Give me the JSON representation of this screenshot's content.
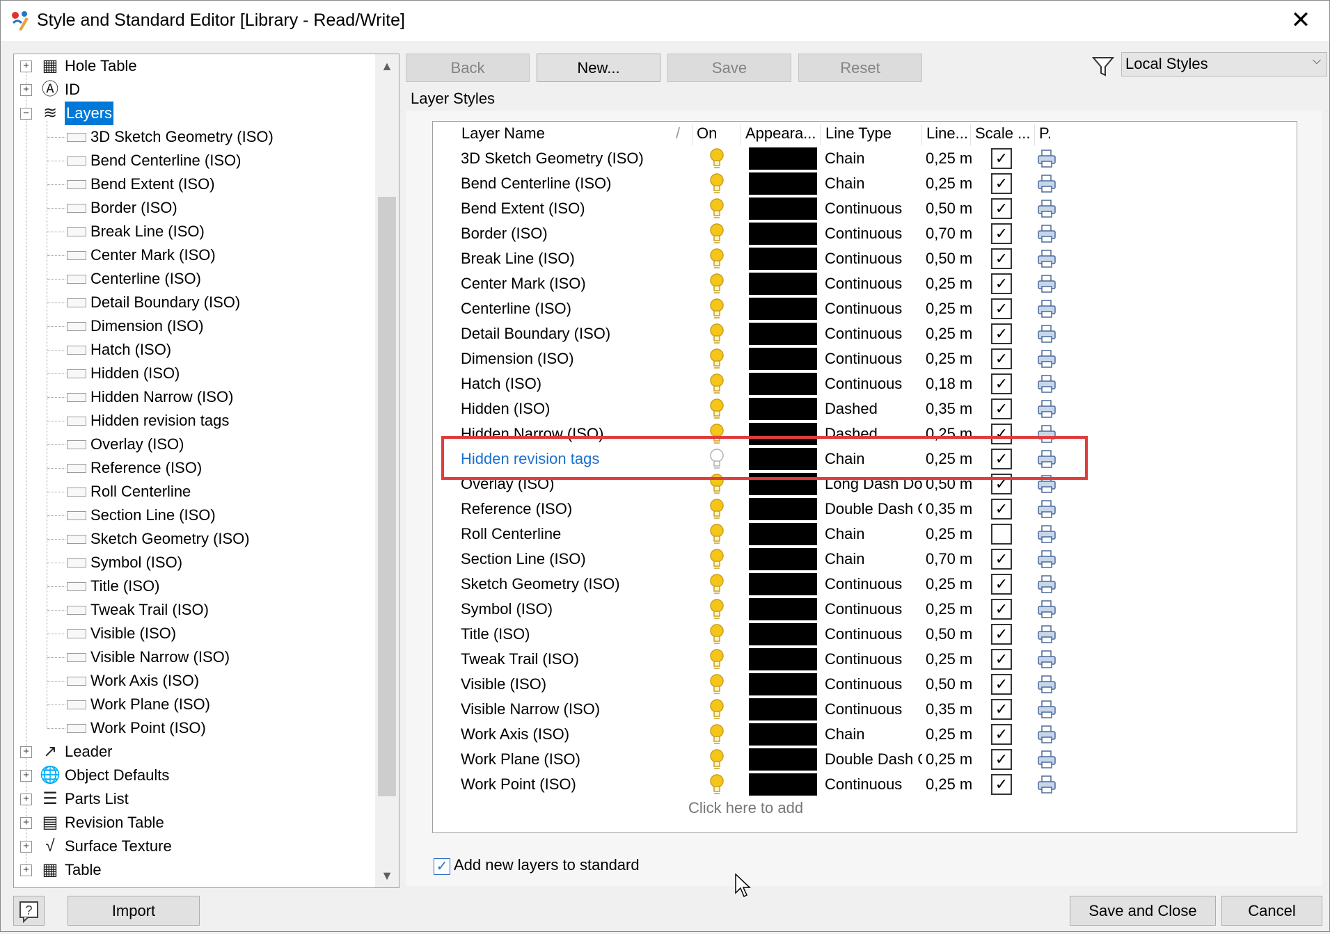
{
  "window": {
    "title": "Style and Standard Editor [Library - Read/Write]",
    "close_glyph": "✕"
  },
  "tree": {
    "top_items": [
      {
        "label": "Hole Table",
        "icon": "hole-table-icon",
        "glyph": "▦",
        "expander": "+"
      },
      {
        "label": "ID",
        "icon": "id-icon",
        "glyph": "Ⓐ",
        "expander": "+"
      },
      {
        "label": "Layers",
        "icon": "layers-icon",
        "glyph": "≋",
        "expander": "−",
        "selected": true
      }
    ],
    "layer_children": [
      "3D Sketch Geometry (ISO)",
      "Bend Centerline (ISO)",
      "Bend Extent (ISO)",
      "Border (ISO)",
      "Break Line (ISO)",
      "Center Mark (ISO)",
      "Centerline (ISO)",
      "Detail Boundary (ISO)",
      "Dimension (ISO)",
      "Hatch (ISO)",
      "Hidden (ISO)",
      "Hidden Narrow (ISO)",
      "Hidden revision tags",
      "Overlay (ISO)",
      "Reference (ISO)",
      "Roll Centerline",
      "Section Line (ISO)",
      "Sketch Geometry (ISO)",
      "Symbol (ISO)",
      "Title (ISO)",
      "Tweak Trail (ISO)",
      "Visible (ISO)",
      "Visible Narrow (ISO)",
      "Work Axis (ISO)",
      "Work Plane (ISO)",
      "Work Point (ISO)"
    ],
    "bottom_items": [
      {
        "label": "Leader",
        "icon": "leader-icon",
        "glyph": "↗",
        "expander": "+"
      },
      {
        "label": "Object Defaults",
        "icon": "globe-icon",
        "glyph": "🌐",
        "expander": "+"
      },
      {
        "label": "Parts List",
        "icon": "parts-list-icon",
        "glyph": "☰",
        "expander": "+"
      },
      {
        "label": "Revision Table",
        "icon": "revision-table-icon",
        "glyph": "▤",
        "expander": "+"
      },
      {
        "label": "Surface Texture",
        "icon": "surface-texture-icon",
        "glyph": "√",
        "expander": "+"
      },
      {
        "label": "Table",
        "icon": "table-icon",
        "glyph": "▦",
        "expander": "+"
      }
    ]
  },
  "toolbar": {
    "back": "Back",
    "new": "New...",
    "save": "Save",
    "reset": "Reset",
    "filter_icon": "funnel-icon",
    "filter_selected": "Local Styles",
    "dropdown_glyph": "⌵"
  },
  "section_label": "Layer Styles",
  "grid": {
    "headers": {
      "name": "Layer Name",
      "sort": "/",
      "on": "On",
      "appearance": "Appeara...",
      "line_type": "Line Type",
      "line_weight": "Line...",
      "scale": "Scale ...",
      "plot": "P."
    },
    "rows": [
      {
        "name": "3D Sketch Geometry (ISO)",
        "on": true,
        "line_type": "Chain",
        "weight": "0,25 m",
        "scale": true
      },
      {
        "name": "Bend Centerline (ISO)",
        "on": true,
        "line_type": "Chain",
        "weight": "0,25 m",
        "scale": true
      },
      {
        "name": "Bend Extent (ISO)",
        "on": true,
        "line_type": "Continuous",
        "weight": "0,50 m",
        "scale": true
      },
      {
        "name": "Border (ISO)",
        "on": true,
        "line_type": "Continuous",
        "weight": "0,70 m",
        "scale": true
      },
      {
        "name": "Break Line (ISO)",
        "on": true,
        "line_type": "Continuous",
        "weight": "0,50 m",
        "scale": true
      },
      {
        "name": "Center Mark (ISO)",
        "on": true,
        "line_type": "Continuous",
        "weight": "0,25 m",
        "scale": true
      },
      {
        "name": "Centerline (ISO)",
        "on": true,
        "line_type": "Continuous",
        "weight": "0,25 m",
        "scale": true
      },
      {
        "name": "Detail Boundary (ISO)",
        "on": true,
        "line_type": "Continuous",
        "weight": "0,25 m",
        "scale": true
      },
      {
        "name": "Dimension (ISO)",
        "on": true,
        "line_type": "Continuous",
        "weight": "0,25 m",
        "scale": true
      },
      {
        "name": "Hatch (ISO)",
        "on": true,
        "line_type": "Continuous",
        "weight": "0,18 m",
        "scale": true
      },
      {
        "name": "Hidden (ISO)",
        "on": true,
        "line_type": "Dashed",
        "weight": "0,35 m",
        "scale": true
      },
      {
        "name": "Hidden Narrow (ISO)",
        "on": true,
        "line_type": "Dashed",
        "weight": "0,25 m",
        "scale": true
      },
      {
        "name": "Hidden revision tags",
        "on": false,
        "line_type": "Chain",
        "weight": "0,25 m",
        "scale": true,
        "highlighted": true
      },
      {
        "name": "Overlay (ISO)",
        "on": true,
        "line_type": "Long Dash Dot",
        "weight": "0,50 m",
        "scale": true
      },
      {
        "name": "Reference (ISO)",
        "on": true,
        "line_type": "Double Dash C",
        "weight": "0,35 m",
        "scale": true
      },
      {
        "name": "Roll Centerline",
        "on": true,
        "line_type": "Chain",
        "weight": "0,25 m",
        "scale": false
      },
      {
        "name": "Section Line (ISO)",
        "on": true,
        "line_type": "Chain",
        "weight": "0,70 m",
        "scale": true
      },
      {
        "name": "Sketch Geometry (ISO)",
        "on": true,
        "line_type": "Continuous",
        "weight": "0,25 m",
        "scale": true
      },
      {
        "name": "Symbol (ISO)",
        "on": true,
        "line_type": "Continuous",
        "weight": "0,25 m",
        "scale": true
      },
      {
        "name": "Title (ISO)",
        "on": true,
        "line_type": "Continuous",
        "weight": "0,50 m",
        "scale": true
      },
      {
        "name": "Tweak Trail (ISO)",
        "on": true,
        "line_type": "Continuous",
        "weight": "0,25 m",
        "scale": true
      },
      {
        "name": "Visible (ISO)",
        "on": true,
        "line_type": "Continuous",
        "weight": "0,50 m",
        "scale": true
      },
      {
        "name": "Visible Narrow (ISO)",
        "on": true,
        "line_type": "Continuous",
        "weight": "0,35 m",
        "scale": true
      },
      {
        "name": "Work Axis (ISO)",
        "on": true,
        "line_type": "Chain",
        "weight": "0,25 m",
        "scale": true
      },
      {
        "name": "Work Plane (ISO)",
        "on": true,
        "line_type": "Double Dash C",
        "weight": "0,25 m",
        "scale": true
      },
      {
        "name": "Work Point (ISO)",
        "on": true,
        "line_type": "Continuous",
        "weight": "0,25 m",
        "scale": true
      }
    ],
    "click_to_add": "Click here to add",
    "check_glyph": "✓"
  },
  "add_to_standard": {
    "label": "Add new layers to standard",
    "checked": true
  },
  "footer": {
    "help_icon": "help-icon",
    "help_glyph": "?",
    "import": "Import",
    "save_close": "Save and Close",
    "cancel": "Cancel"
  },
  "colors": {
    "selection": "#0078d7",
    "highlight_text": "#1a6fcf",
    "highlight_box": "#e03c3c",
    "bulb_on": "#f5c518"
  }
}
